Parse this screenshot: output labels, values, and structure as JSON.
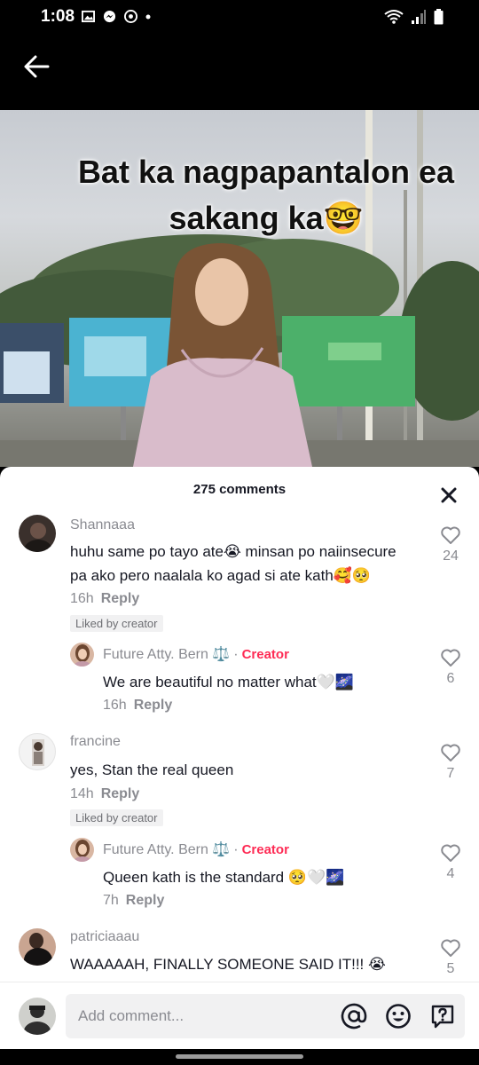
{
  "status_bar": {
    "time": "1:08",
    "left_icons": [
      "gallery-icon",
      "messenger-icon",
      "chrome-icon",
      "notification-dot-icon"
    ],
    "right_icons": [
      "wifi-icon",
      "signal-icon",
      "battery-icon"
    ]
  },
  "video": {
    "overlay_line1": "Bat ka nagpapantalon ea",
    "overlay_line2": "sakang ka",
    "overlay_emoji": "🤓"
  },
  "comments_sheet": {
    "title": "275 comments",
    "comments": [
      {
        "username": "Shannaaa",
        "text_line1": "huhu same po tayo ate😭 minsan po naiinsecure",
        "text_line2": "pa ako pero naalala ko agad si ate kath🥰🥺",
        "time": "16h",
        "reply_label": "Reply",
        "liked_by_creator": "Liked by creator",
        "likes": "24",
        "reply": {
          "username": "Future Atty. Bern ⚖️",
          "dot": "·",
          "creator_label": "Creator",
          "text": "We are beautiful no matter what🤍🌌",
          "time": "16h",
          "reply_label": "Reply",
          "likes": "6"
        }
      },
      {
        "username": "francine",
        "text_line1": "yes, Stan the real queen",
        "time": "14h",
        "reply_label": "Reply",
        "liked_by_creator": "Liked by creator",
        "likes": "7",
        "reply": {
          "username": "Future Atty. Bern ⚖️",
          "dot": "·",
          "creator_label": "Creator",
          "text": "Queen kath is the standard 🥺🤍🌌",
          "time": "7h",
          "reply_label": "Reply",
          "likes": "4"
        }
      },
      {
        "username": "patriciaaau",
        "text_line1": "WAAAAAH, FINALLY SOMEONE SAID IT!!! 😭",
        "likes": "5"
      }
    ]
  },
  "comment_input": {
    "placeholder": "Add comment...",
    "buttons": [
      "mention-icon",
      "emoji-icon",
      "question-icon"
    ]
  },
  "colors": {
    "creator_accent": "#fe2c55",
    "muted_text": "#8a8b91",
    "primary_text": "#161823"
  }
}
